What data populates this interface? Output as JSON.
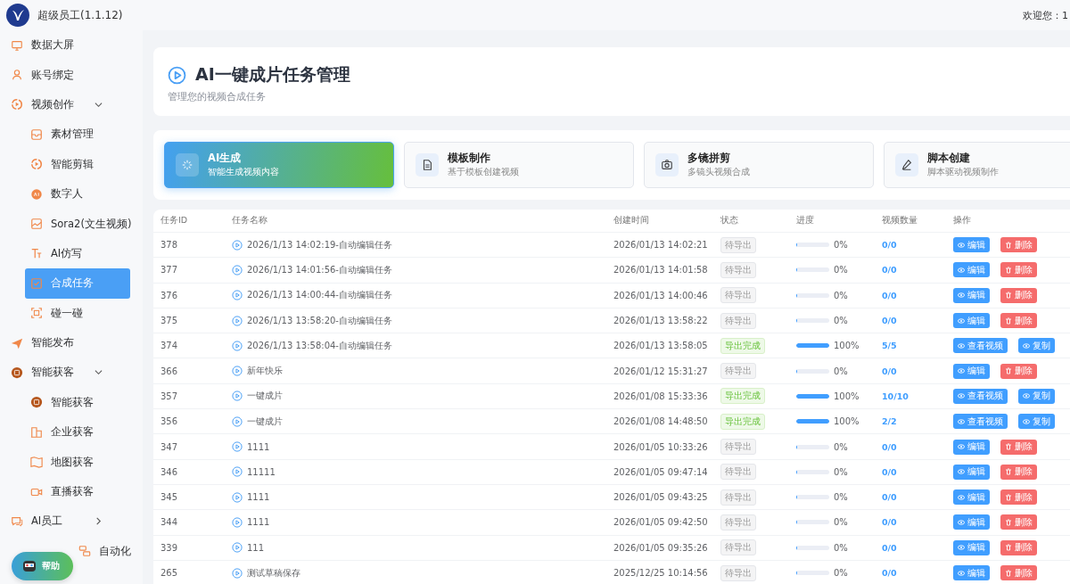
{
  "app": {
    "title": "超级员工(1.1.12)",
    "welcome": "欢迎您：1"
  },
  "sidebar": {
    "items": [
      {
        "label": "数据大屏",
        "selected": false
      },
      {
        "label": "账号绑定",
        "selected": false
      },
      {
        "label": "视频创作",
        "selected": false,
        "expanded": true,
        "children": [
          {
            "label": "素材管理",
            "selected": false
          },
          {
            "label": "智能剪辑",
            "selected": false
          },
          {
            "label": "数字人",
            "selected": false
          },
          {
            "label": "Sora2(文生视频)",
            "selected": false
          },
          {
            "label": "AI仿写",
            "selected": false
          },
          {
            "label": "合成任务",
            "selected": true
          },
          {
            "label": "碰一碰",
            "selected": false
          }
        ]
      },
      {
        "label": "智能发布",
        "selected": false
      },
      {
        "label": "智能获客",
        "selected": false,
        "expanded": true,
        "children": [
          {
            "label": "智能获客",
            "selected": false
          },
          {
            "label": "企业获客",
            "selected": false
          },
          {
            "label": "地图获客",
            "selected": false
          },
          {
            "label": "直播获客",
            "selected": false
          }
        ]
      },
      {
        "label": "AI员工",
        "selected": false,
        "expanded": false
      },
      {
        "label": "自动化",
        "selected": false
      }
    ],
    "help": {
      "label": "帮助"
    }
  },
  "header": {
    "title": "AI一键成片任务管理",
    "subtitle": "管理您的视频合成任务"
  },
  "modes": [
    {
      "title": "AI生成",
      "subtitle": "智能生成视频内容",
      "selected": true
    },
    {
      "title": "模板制作",
      "subtitle": "基于模板创建视频",
      "selected": false
    },
    {
      "title": "多镜拼剪",
      "subtitle": "多镜头视频合成",
      "selected": false
    },
    {
      "title": "脚本创建",
      "subtitle": "脚本驱动视频制作",
      "selected": false
    }
  ],
  "table": {
    "columns": [
      "任务ID",
      "任务名称",
      "创建时间",
      "状态",
      "进度",
      "视频数量",
      "操作"
    ],
    "rows": [
      {
        "id": "378",
        "name": "2026/1/13 14:02:19-自动编辑任务",
        "created": "2026/01/13 14:02:21",
        "status": {
          "kind": "pending",
          "label": "待导出"
        },
        "level": 0,
        "percent": "0%",
        "count": "0/0",
        "actions": [
          {
            "kind": "primary",
            "label": "编辑"
          },
          {
            "kind": "danger",
            "label": "删除"
          }
        ]
      },
      {
        "id": "377",
        "name": "2026/1/13 14:01:56-自动编辑任务",
        "created": "2026/01/13 14:01:58",
        "status": {
          "kind": "pending",
          "label": "待导出"
        },
        "level": 0,
        "percent": "0%",
        "count": "0/0",
        "actions": [
          {
            "kind": "primary",
            "label": "编辑"
          },
          {
            "kind": "danger",
            "label": "删除"
          }
        ]
      },
      {
        "id": "376",
        "name": "2026/1/13 14:00:44-自动编辑任务",
        "created": "2026/01/13 14:00:46",
        "status": {
          "kind": "pending",
          "label": "待导出"
        },
        "level": 0,
        "percent": "0%",
        "count": "0/0",
        "actions": [
          {
            "kind": "primary",
            "label": "编辑"
          },
          {
            "kind": "danger",
            "label": "删除"
          }
        ]
      },
      {
        "id": "375",
        "name": "2026/1/13 13:58:20-自动编辑任务",
        "created": "2026/01/13 13:58:22",
        "status": {
          "kind": "pending",
          "label": "待导出"
        },
        "level": 0,
        "percent": "0%",
        "count": "0/0",
        "actions": [
          {
            "kind": "primary",
            "label": "编辑"
          },
          {
            "kind": "danger",
            "label": "删除"
          }
        ]
      },
      {
        "id": "374",
        "name": "2026/1/13 13:58:04-自动编辑任务",
        "created": "2026/01/13 13:58:05",
        "status": {
          "kind": "done",
          "label": "导出完成"
        },
        "level": 1,
        "percent": "100%",
        "count": "5/5",
        "actions": [
          {
            "kind": "primary",
            "label": "查看视频"
          },
          {
            "kind": "primary",
            "label": "复制"
          }
        ]
      },
      {
        "id": "366",
        "name": "新年快乐",
        "created": "2026/01/12 15:31:27",
        "status": {
          "kind": "pending",
          "label": "待导出"
        },
        "level": 0,
        "percent": "0%",
        "count": "0/0",
        "actions": [
          {
            "kind": "primary",
            "label": "编辑"
          },
          {
            "kind": "danger",
            "label": "删除"
          }
        ]
      },
      {
        "id": "357",
        "name": "一键成片",
        "created": "2026/01/08 15:33:36",
        "status": {
          "kind": "done",
          "label": "导出完成"
        },
        "level": 1,
        "percent": "100%",
        "count": "10/10",
        "actions": [
          {
            "kind": "primary",
            "label": "查看视频"
          },
          {
            "kind": "primary",
            "label": "复制"
          }
        ]
      },
      {
        "id": "356",
        "name": "一键成片",
        "created": "2026/01/08 14:48:50",
        "status": {
          "kind": "done",
          "label": "导出完成"
        },
        "level": 1,
        "percent": "100%",
        "count": "2/2",
        "actions": [
          {
            "kind": "primary",
            "label": "查看视频"
          },
          {
            "kind": "primary",
            "label": "复制"
          }
        ]
      },
      {
        "id": "347",
        "name": "1111",
        "created": "2026/01/05 10:33:26",
        "status": {
          "kind": "pending",
          "label": "待导出"
        },
        "level": 0,
        "percent": "0%",
        "count": "0/0",
        "actions": [
          {
            "kind": "primary",
            "label": "编辑"
          },
          {
            "kind": "danger",
            "label": "删除"
          }
        ]
      },
      {
        "id": "346",
        "name": "11111",
        "created": "2026/01/05 09:47:14",
        "status": {
          "kind": "pending",
          "label": "待导出"
        },
        "level": 0,
        "percent": "0%",
        "count": "0/0",
        "actions": [
          {
            "kind": "primary",
            "label": "编辑"
          },
          {
            "kind": "danger",
            "label": "删除"
          }
        ]
      },
      {
        "id": "345",
        "name": "1111",
        "created": "2026/01/05 09:43:25",
        "status": {
          "kind": "pending",
          "label": "待导出"
        },
        "level": 0,
        "percent": "0%",
        "count": "0/0",
        "actions": [
          {
            "kind": "primary",
            "label": "编辑"
          },
          {
            "kind": "danger",
            "label": "删除"
          }
        ]
      },
      {
        "id": "344",
        "name": "1111",
        "created": "2026/01/05 09:42:50",
        "status": {
          "kind": "pending",
          "label": "待导出"
        },
        "level": 0,
        "percent": "0%",
        "count": "0/0",
        "actions": [
          {
            "kind": "primary",
            "label": "编辑"
          },
          {
            "kind": "danger",
            "label": "删除"
          }
        ]
      },
      {
        "id": "339",
        "name": "111",
        "created": "2026/01/05 09:35:26",
        "status": {
          "kind": "pending",
          "label": "待导出"
        },
        "level": 0,
        "percent": "0%",
        "count": "0/0",
        "actions": [
          {
            "kind": "primary",
            "label": "编辑"
          },
          {
            "kind": "danger",
            "label": "删除"
          }
        ]
      },
      {
        "id": "265",
        "name": "测试草稿保存",
        "created": "2025/12/25 10:14:56",
        "status": {
          "kind": "pending",
          "label": "待导出"
        },
        "level": 0,
        "percent": "0%",
        "count": "0/0",
        "actions": [
          {
            "kind": "primary",
            "label": "编辑"
          },
          {
            "kind": "danger",
            "label": "删除"
          }
        ]
      }
    ]
  }
}
